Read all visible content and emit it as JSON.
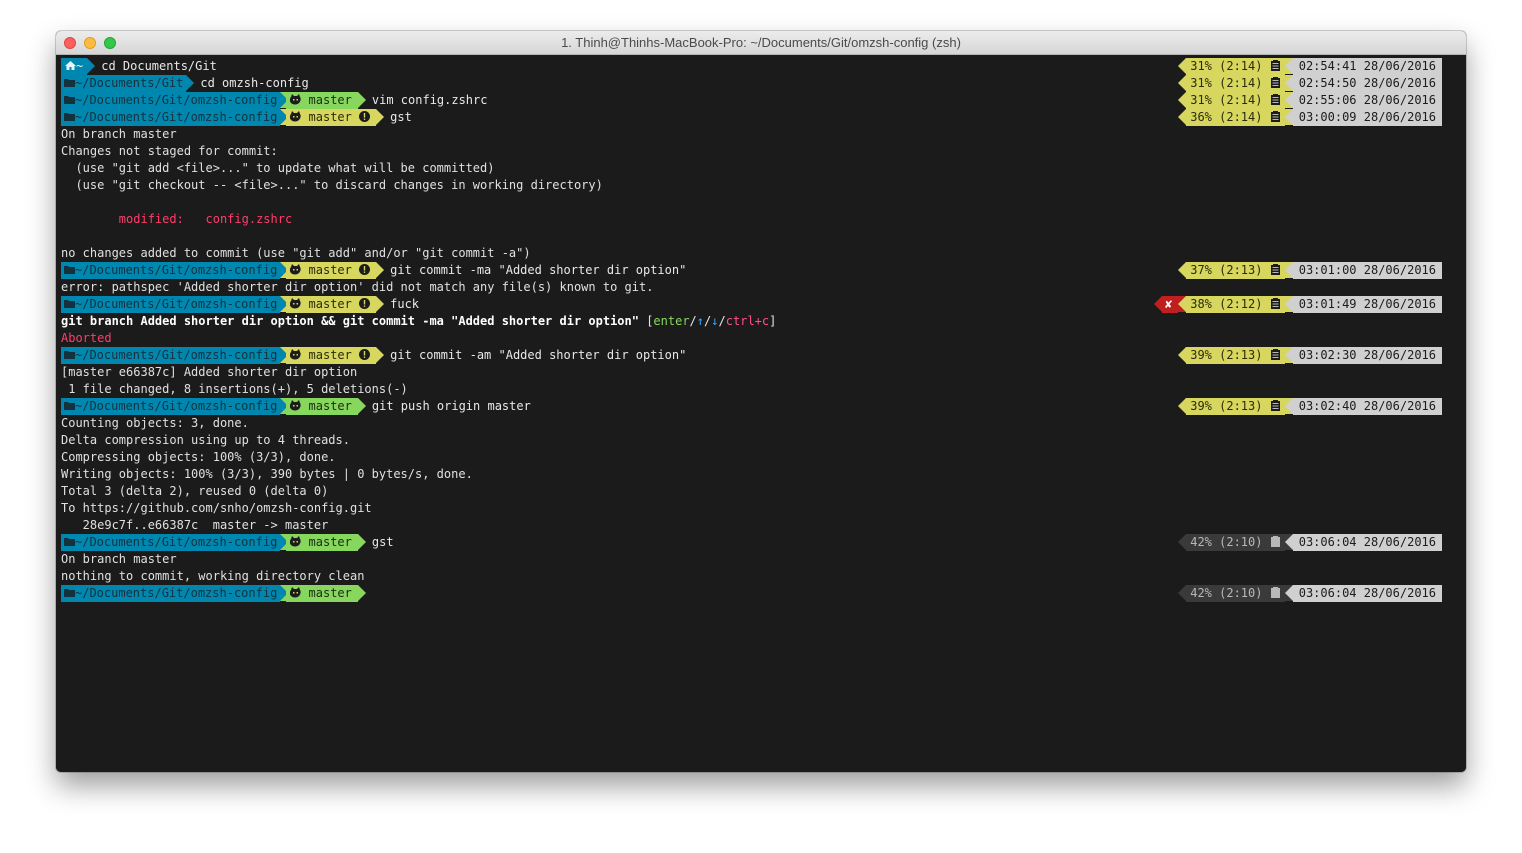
{
  "window": {
    "title": "1. Thinh@Thinhs-MacBook-Pro: ~/Documents/Git/omzsh-config (zsh)"
  },
  "colors": {
    "dir_segment": "#0087af",
    "git_clean": "#87d75f",
    "git_dirty": "#d7d75f",
    "battery": "#d7d75f",
    "time": "#d0d0d0",
    "error": "#bf1f1f",
    "modified": "#ff3d6b"
  },
  "icons": {
    "home": "home-icon",
    "folder": "folder-icon",
    "git": "octocat-icon",
    "branch": "branch-icon",
    "dirty": "exclamation-icon",
    "battery": "battery-icon",
    "error": "cross-icon"
  },
  "lines": [
    {
      "type": "prompt",
      "dir": "~",
      "home": true,
      "git": null,
      "cmd": "cd Documents/Git",
      "bat": "31% (2:14)",
      "time": "02:54:41 28/06/2016"
    },
    {
      "type": "prompt",
      "dir": "~/Documents/Git",
      "git": null,
      "cmd": "cd omzsh-config",
      "bat": "31% (2:14)",
      "time": "02:54:50 28/06/2016"
    },
    {
      "type": "prompt",
      "dir": "~/Documents/Git/omzsh-config",
      "git": "master",
      "dirty": false,
      "cmd": "vim config.zshrc",
      "bat": "31% (2:14)",
      "time": "02:55:06 28/06/2016"
    },
    {
      "type": "prompt",
      "dir": "~/Documents/Git/omzsh-config",
      "git": "master",
      "dirty": true,
      "cmd": "gst",
      "bat": "36% (2:14)",
      "time": "03:00:09 28/06/2016"
    },
    {
      "type": "out",
      "text": "On branch master"
    },
    {
      "type": "out",
      "text": "Changes not staged for commit:"
    },
    {
      "type": "out",
      "text": "  (use \"git add <file>...\" to update what will be committed)"
    },
    {
      "type": "out",
      "text": "  (use \"git checkout -- <file>...\" to discard changes in working directory)"
    },
    {
      "type": "out",
      "text": ""
    },
    {
      "type": "mod",
      "text": "        modified:   config.zshrc"
    },
    {
      "type": "out",
      "text": ""
    },
    {
      "type": "out",
      "text": "no changes added to commit (use \"git add\" and/or \"git commit -a\")"
    },
    {
      "type": "prompt",
      "dir": "~/Documents/Git/omzsh-config",
      "git": "master",
      "dirty": true,
      "cmd": "git commit -ma \"Added shorter dir option\"",
      "bat": "37% (2:13)",
      "time": "03:01:00 28/06/2016"
    },
    {
      "type": "out",
      "text": "error: pathspec 'Added shorter dir option' did not match any file(s) known to git."
    },
    {
      "type": "prompt",
      "dir": "~/Documents/Git/omzsh-config",
      "git": "master",
      "dirty": true,
      "cmd": "fuck",
      "bat": "38% (2:12)",
      "time": "03:01:49 28/06/2016",
      "error": "✘"
    },
    {
      "type": "fuck",
      "bold": "git branch Added shorter dir option && git commit -ma \"Added shorter dir option\"",
      "p1": " [",
      "enter": "enter",
      "s1": "/",
      "up": "↑",
      "s2": "/",
      "down": "↓",
      "s3": "/",
      "ctrl": "ctrl+c",
      "p2": "]"
    },
    {
      "type": "aborted",
      "text": "Aborted"
    },
    {
      "type": "prompt",
      "dir": "~/Documents/Git/omzsh-config",
      "git": "master",
      "dirty": true,
      "cmd": "git commit -am \"Added shorter dir option\"",
      "bat": "39% (2:13)",
      "time": "03:02:30 28/06/2016"
    },
    {
      "type": "out",
      "text": "[master e66387c] Added shorter dir option"
    },
    {
      "type": "out",
      "text": " 1 file changed, 8 insertions(+), 5 deletions(-)"
    },
    {
      "type": "prompt",
      "dir": "~/Documents/Git/omzsh-config",
      "git": "master",
      "dirty": false,
      "cmd": "git push origin master",
      "bat": "39% (2:13)",
      "time": "03:02:40 28/06/2016"
    },
    {
      "type": "out",
      "text": "Counting objects: 3, done."
    },
    {
      "type": "out",
      "text": "Delta compression using up to 4 threads."
    },
    {
      "type": "out",
      "text": "Compressing objects: 100% (3/3), done."
    },
    {
      "type": "out",
      "text": "Writing objects: 100% (3/3), 390 bytes | 0 bytes/s, done."
    },
    {
      "type": "out",
      "text": "Total 3 (delta 2), reused 0 (delta 0)"
    },
    {
      "type": "out",
      "text": "To https://github.com/snho/omzsh-config.git"
    },
    {
      "type": "out",
      "text": "   28e9c7f..e66387c  master -> master"
    },
    {
      "type": "prompt",
      "dir": "~/Documents/Git/omzsh-config",
      "git": "master",
      "dirty": false,
      "cmd": "gst",
      "bat": "42% (2:10)",
      "time": "03:06:04 28/06/2016",
      "charging": true
    },
    {
      "type": "out",
      "text": "On branch master"
    },
    {
      "type": "out",
      "text": "nothing to commit, working directory clean"
    },
    {
      "type": "prompt",
      "dir": "~/Documents/Git/omzsh-config",
      "git": "master",
      "dirty": false,
      "cmd": "",
      "bat": "42% (2:10)",
      "time": "03:06:04 28/06/2016",
      "charging": true
    }
  ]
}
